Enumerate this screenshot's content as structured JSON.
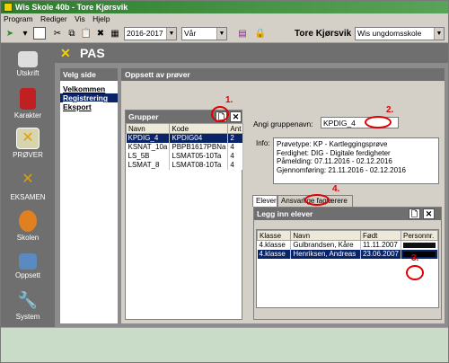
{
  "window": {
    "title": "Wis Skole 40b  -  Tore Kjørsvik"
  },
  "menu": [
    "Program",
    "Rediger",
    "Vis",
    "Hjelp"
  ],
  "toolbar": {
    "year": "2016-2017",
    "term": "Vår",
    "user": "Tore Kjørsvik",
    "school": "Wis ungdomsskole"
  },
  "sidebar": {
    "items": [
      {
        "label": "Utskrift",
        "icon": "printer-icon"
      },
      {
        "label": "Karakter",
        "icon": "grades-book-icon"
      },
      {
        "label": "PRØVER",
        "icon": "tools-icon"
      },
      {
        "label": "EKSAMEN",
        "icon": "tools-icon"
      },
      {
        "label": "Skolen",
        "icon": "people-icon"
      },
      {
        "label": "Oppsett",
        "icon": "computer-icon"
      },
      {
        "label": "System",
        "icon": "wrench-icon"
      }
    ]
  },
  "header": {
    "title": "PAS"
  },
  "leftnav": {
    "heading": "Velg side",
    "items": [
      "Velkommen",
      "Registrering",
      "Eksport"
    ]
  },
  "main": {
    "heading": "Oppsett av prøver"
  },
  "grupper": {
    "heading": "Grupper",
    "columns": [
      "Navn",
      "Kode",
      "Ant"
    ],
    "rows": [
      [
        "KPDIG_4",
        "KPDIG04",
        "2"
      ],
      [
        "KSNAT_10a",
        "PBPB1617PBNa",
        "4"
      ],
      [
        "LS_5B",
        "LSMAT05-10Ta",
        "4"
      ],
      [
        "LSMAT_8",
        "LSMAT08-10Ta",
        "4"
      ]
    ]
  },
  "group_name": {
    "label": "Angi gruppenavn:",
    "value": "KPDIG_4"
  },
  "info": {
    "label": "Info:",
    "lines": [
      "Prøvetype: KP - Kartleggingsprøve",
      "Ferdighet: DIG - Digitale ferdigheter",
      "Påmelding: 07.11.2016 - 02.12.2016",
      "Gjennomføring: 21.11.2016 - 02.12.2016"
    ]
  },
  "tabs": [
    "Elever",
    "Ansvarlige faglærere"
  ],
  "elever": {
    "heading": "Legg inn elever",
    "columns": [
      "Klasse",
      "Navn",
      "Født",
      "Personnr."
    ],
    "rows": [
      [
        "4.klasse",
        "Gulbrandsen, Kåre",
        "11.11.2007"
      ],
      [
        "4.klasse",
        "Henriksen, Andreas",
        "23.06.2007"
      ]
    ]
  },
  "annotations": [
    "1.",
    "2.",
    "3.",
    "4."
  ],
  "colors": {
    "accent": "#0a246a",
    "header_gray": "#6f6f6f",
    "annotation_red": "#e00000",
    "status_green": "#c8dcc8"
  }
}
